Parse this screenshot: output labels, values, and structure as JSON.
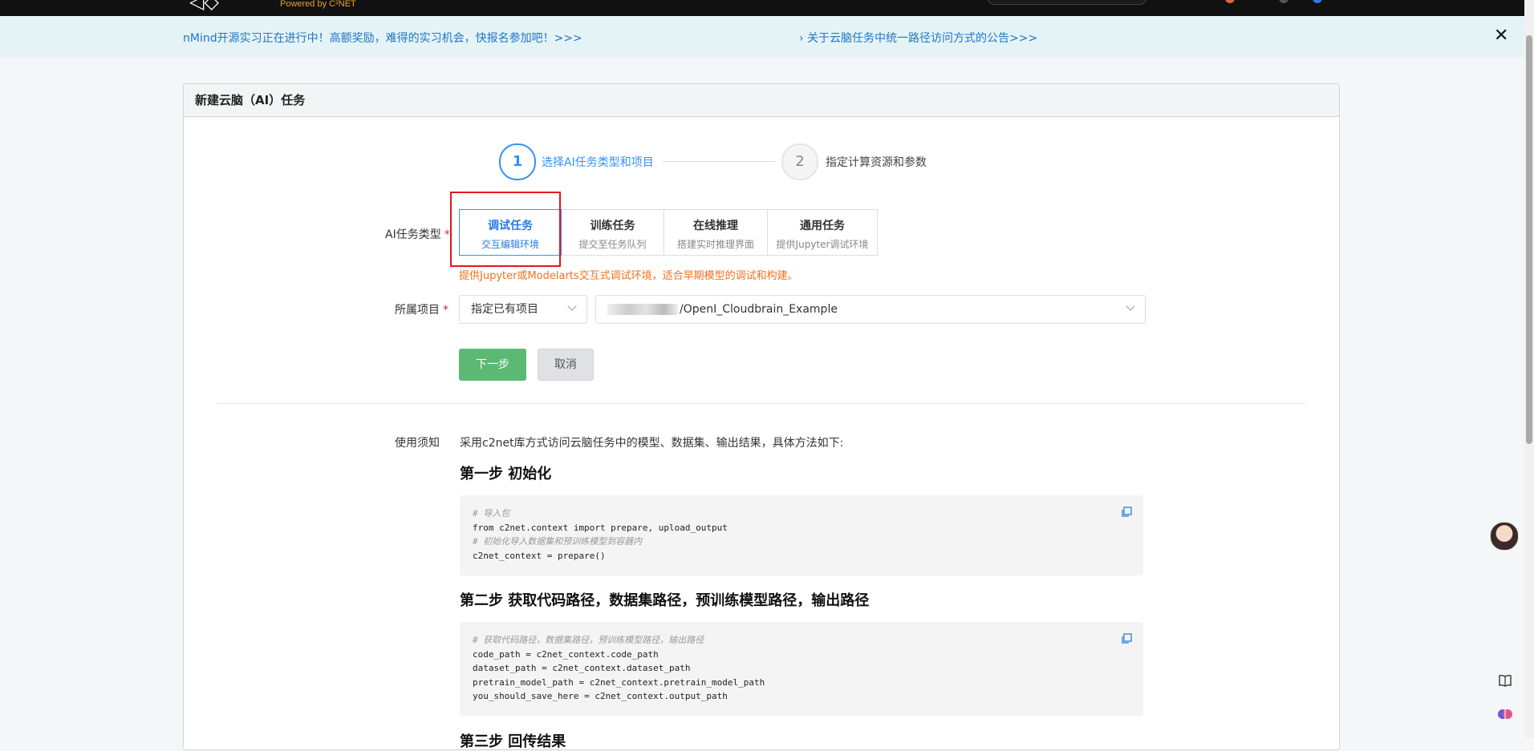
{
  "topbar": {
    "powered_by": "Powered by C²NET"
  },
  "notices": {
    "left": "nMind开源实习正在进行中！高额奖励，难得的实习机会，快报名参加吧！>>>",
    "right": "关于云脑任务中统一路径访问方式的公告>>>",
    "right_chevron": "›",
    "close": "✕"
  },
  "card": {
    "title": "新建云脑（AI）任务"
  },
  "steps": [
    {
      "number": "1",
      "label": "选择AI任务类型和项目",
      "active": true
    },
    {
      "number": "2",
      "label": "指定计算资源和参数",
      "active": false
    }
  ],
  "form": {
    "task_type_label": "AI任务类型",
    "required_mark": "*",
    "task_options": [
      {
        "title": "调试任务",
        "subtitle": "交互编辑环境",
        "selected": true
      },
      {
        "title": "训练任务",
        "subtitle": "提交至任务队列",
        "selected": false
      },
      {
        "title": "在线推理",
        "subtitle": "搭建实时推理界面",
        "selected": false
      },
      {
        "title": "通用任务",
        "subtitle": "提供Jupyter调试环境",
        "selected": false
      }
    ],
    "task_hint": "提供Jupyter或Modelarts交互式调试环境，适合早期模型的调试和构建。",
    "project_label": "所属项目",
    "project_mode": "指定已有项目",
    "project_repo": "/OpenI_Cloudbrain_Example",
    "next_button": "下一步",
    "cancel_button": "取消"
  },
  "usage": {
    "label": "使用须知",
    "intro": "采用c2net库方式访问云脑任务中的模型、数据集、输出结果，具体方法如下:",
    "step1_title": "第一步 初始化",
    "step1_code": [
      {
        "text": "# 导入包",
        "comment": true
      },
      {
        "text": "from c2net.context import prepare, upload_output",
        "comment": false
      },
      {
        "text": "# 初始化导入数据集和预训练模型到容器内",
        "comment": true
      },
      {
        "text": "c2net_context = prepare()",
        "comment": false
      }
    ],
    "step2_title": "第二步 获取代码路径，数据集路径，预训练模型路径，输出路径",
    "step2_code": [
      {
        "text": "# 获取代码路径，数据集路径，预训练模型路径，输出路径",
        "comment": true
      },
      {
        "text": "code_path = c2net_context.code_path",
        "comment": false
      },
      {
        "text": "dataset_path = c2net_context.dataset_path",
        "comment": false
      },
      {
        "text": "pretrain_model_path = c2net_context.pretrain_model_path",
        "comment": false
      },
      {
        "text": "you_should_save_here = c2net_context.output_path",
        "comment": false
      }
    ],
    "step3_title": "第三步 回传结果"
  },
  "colors": {
    "accent": "#3291f8",
    "next_button": "#5bb974",
    "warning_text": "#f2711c",
    "highlight": "#e6151b"
  }
}
